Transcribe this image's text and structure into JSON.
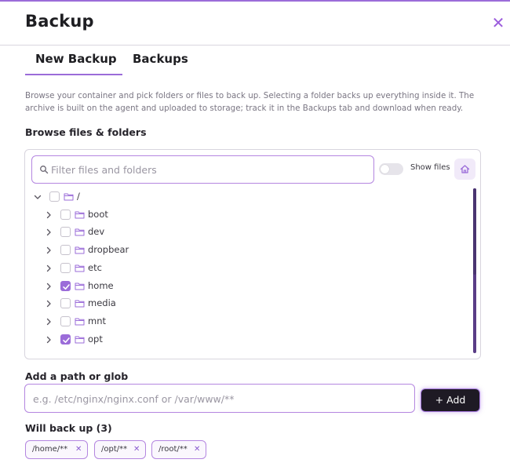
{
  "dialog": {
    "title": "Backup"
  },
  "tabs": [
    {
      "label": "New Backup",
      "active": true
    },
    {
      "label": "Backups",
      "active": false
    }
  ],
  "description": "Browse your container and pick folders or files to back up. Selecting a folder backs up everything inside it. The archive is built on the agent and uploaded to storage; track it in the Backups tab and download when ready.",
  "browser": {
    "section_label": "Browse files & folders",
    "filter_placeholder": "Filter files and folders",
    "show_files_label": "Show files",
    "show_files_on": false,
    "tree": [
      {
        "name": "/",
        "expanded": true,
        "checked": false,
        "depth": 0
      },
      {
        "name": "boot",
        "expanded": false,
        "checked": false,
        "depth": 1
      },
      {
        "name": "dev",
        "expanded": false,
        "checked": false,
        "depth": 1
      },
      {
        "name": "dropbear",
        "expanded": false,
        "checked": false,
        "depth": 1
      },
      {
        "name": "etc",
        "expanded": false,
        "checked": false,
        "depth": 1
      },
      {
        "name": "home",
        "expanded": false,
        "checked": true,
        "depth": 1
      },
      {
        "name": "media",
        "expanded": false,
        "checked": false,
        "depth": 1
      },
      {
        "name": "mnt",
        "expanded": false,
        "checked": false,
        "depth": 1
      },
      {
        "name": "opt",
        "expanded": false,
        "checked": true,
        "depth": 1
      }
    ]
  },
  "path_entry": {
    "section_label": "Add a path or glob",
    "placeholder": "e.g. /etc/nginx/nginx.conf or /var/www/**",
    "add_label": "+ Add"
  },
  "selection": {
    "section_label": "Will back up (3)",
    "chips": [
      "/home/**",
      "/opt/**",
      "/root/**"
    ]
  },
  "colors": {
    "accent": "#9b6cd9",
    "primary_button": "#1e1a24"
  }
}
